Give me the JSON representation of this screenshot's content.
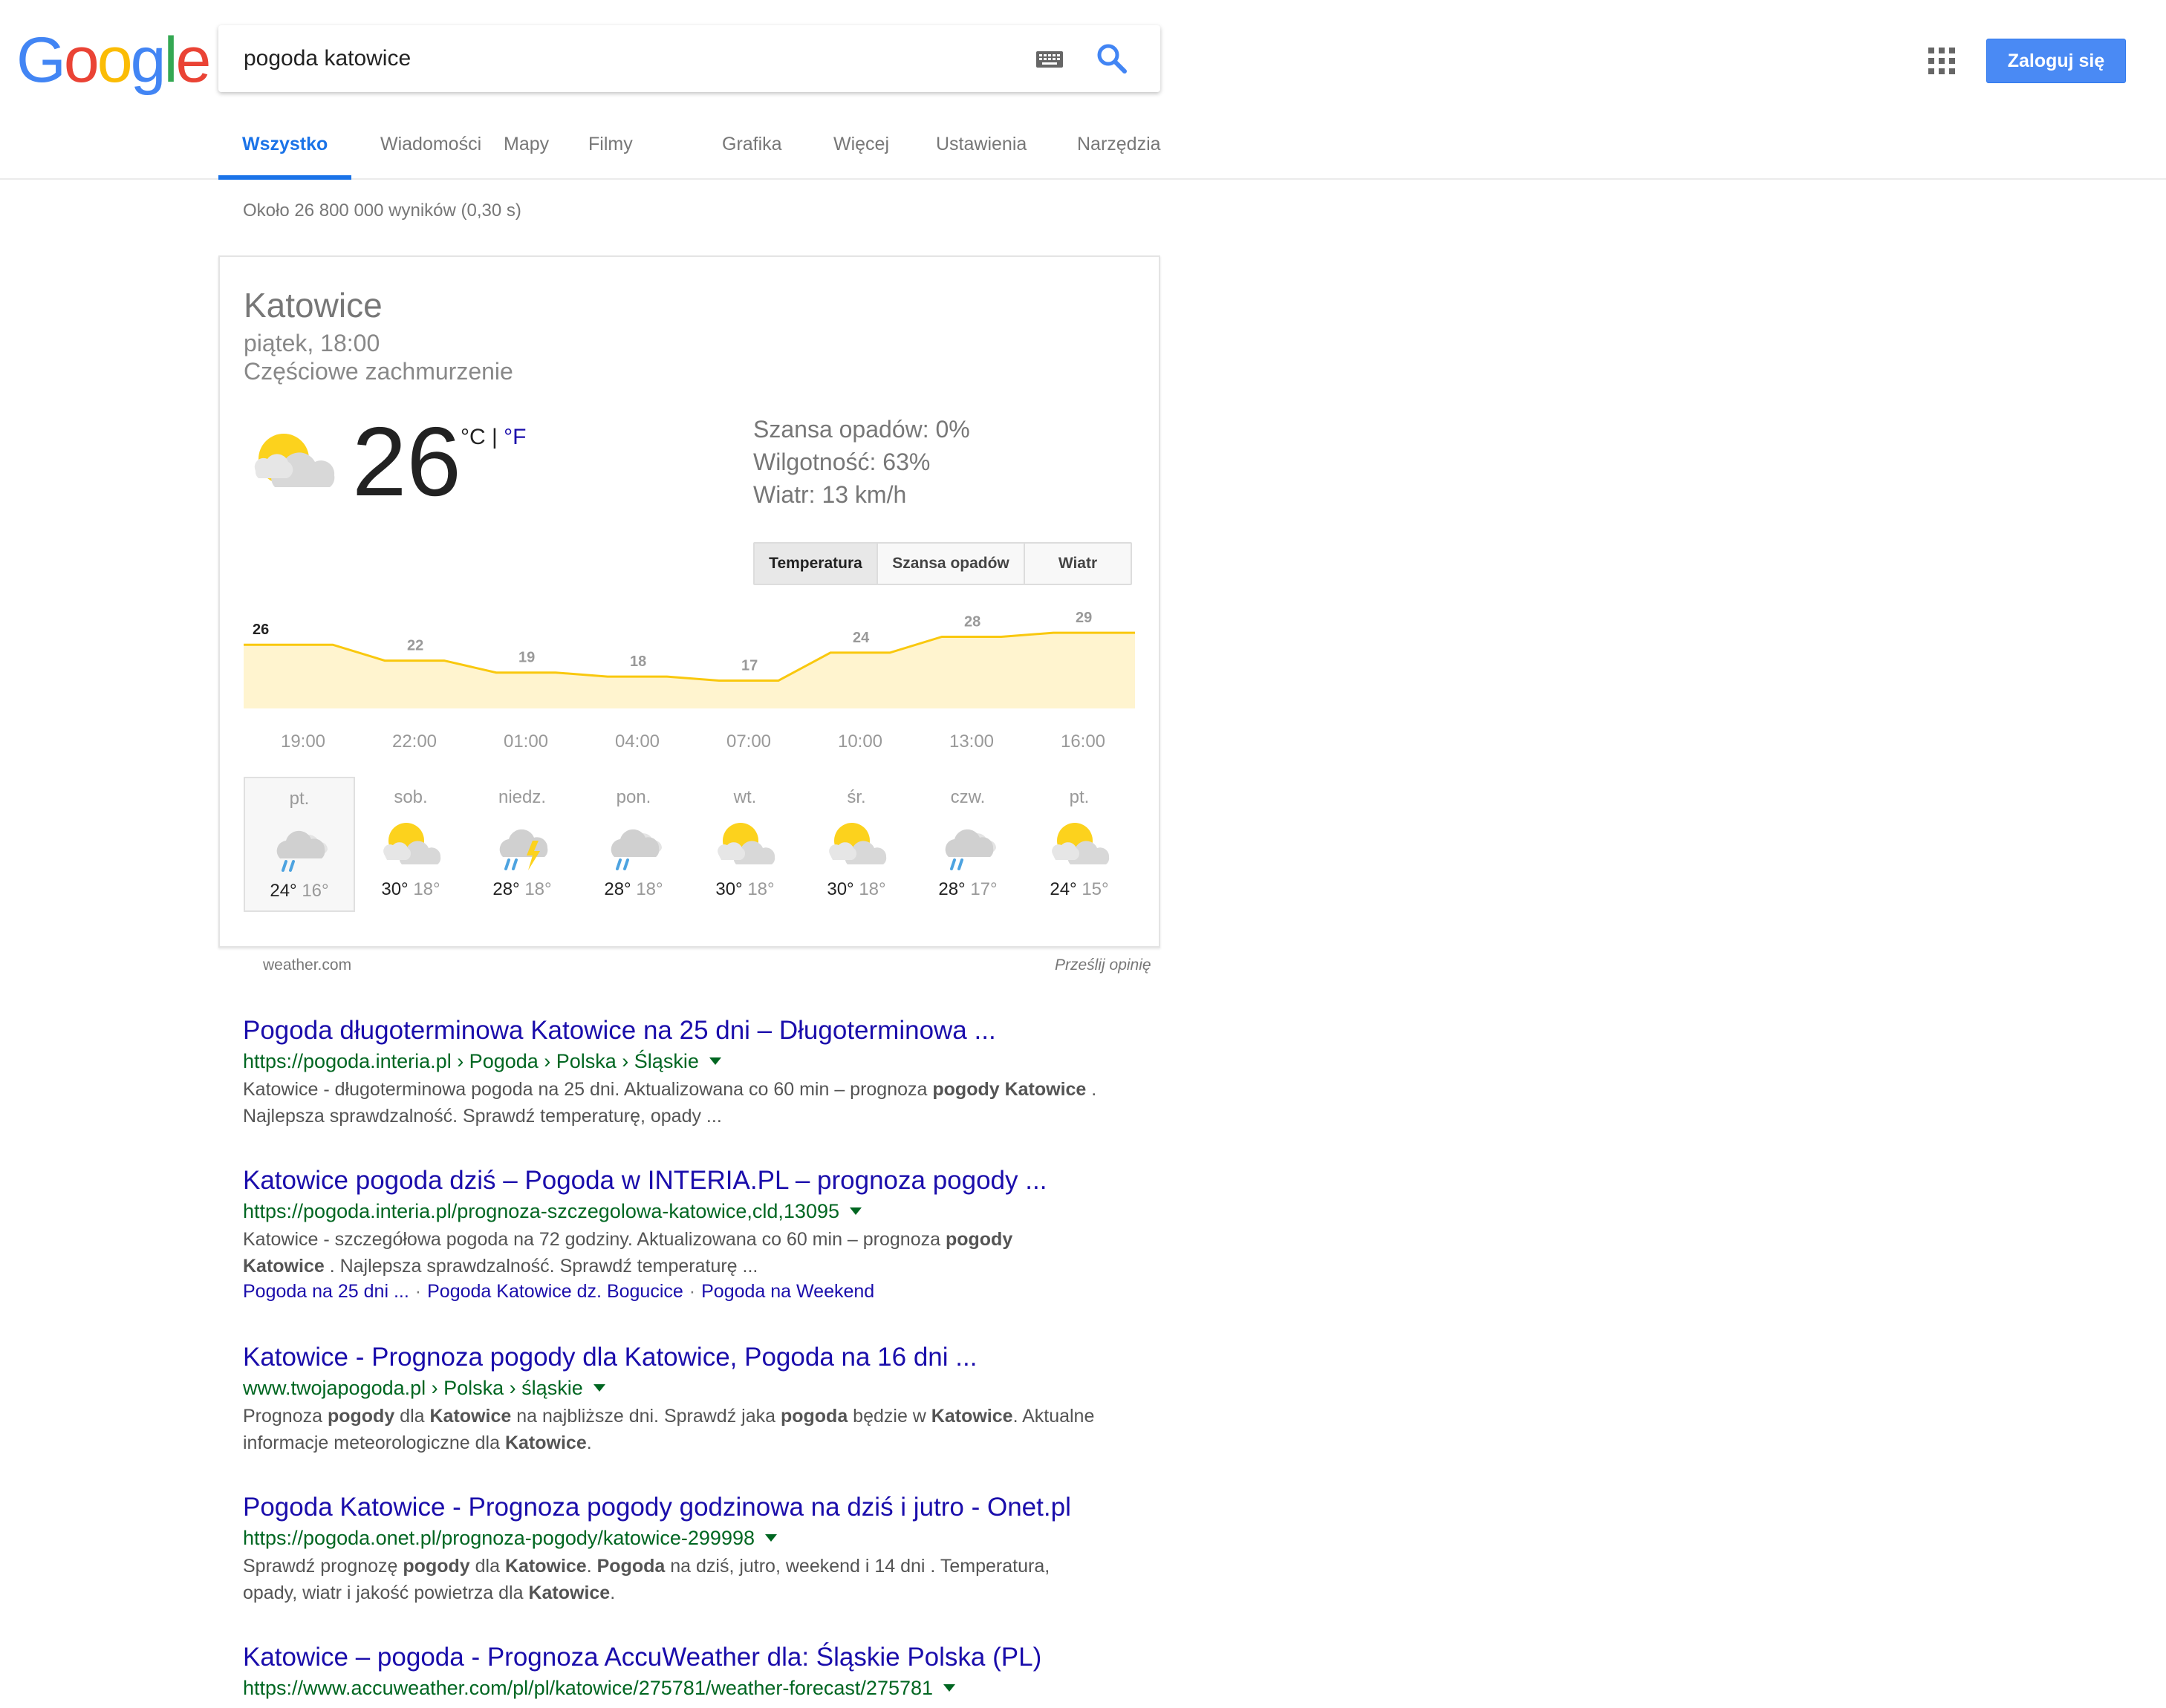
{
  "header": {
    "logo_letters": [
      {
        "ch": "G",
        "color": "#4285F4"
      },
      {
        "ch": "o",
        "color": "#EA4335"
      },
      {
        "ch": "o",
        "color": "#FBBC05"
      },
      {
        "ch": "g",
        "color": "#4285F4"
      },
      {
        "ch": "l",
        "color": "#34A853"
      },
      {
        "ch": "e",
        "color": "#EA4335"
      }
    ],
    "search_value": "pogoda katowice",
    "login_label": "Zaloguj się",
    "accent_color": "#4a8af4"
  },
  "tabs": [
    {
      "label": "Wszystko",
      "active": true
    },
    {
      "label": "Wiadomości",
      "active": false
    },
    {
      "label": "Mapy",
      "active": false
    },
    {
      "label": "Filmy",
      "active": false
    },
    {
      "label": "Grafika",
      "active": false
    },
    {
      "label": "Więcej",
      "active": false
    },
    {
      "label": "Ustawienia",
      "active": false
    },
    {
      "label": "Narzędzia",
      "active": false
    }
  ],
  "result_stats": "Około 26 800 000 wyników (0,30 s)",
  "weather": {
    "city": "Katowice",
    "time": "piątek, 18:00",
    "description": "Częściowe zachmurzenie",
    "icon": "partly-cloudy-icon",
    "temperature": "26",
    "unit_c": "°C",
    "unit_sep": " | ",
    "unit_f": "°F",
    "precipitation": "Szansa opadów: 0%",
    "humidity": "Wilgotność: 63%",
    "wind": "Wiatr: 13 km/h",
    "buttons": [
      {
        "label": "Temperatura",
        "selected": true
      },
      {
        "label": "Szansa opadów",
        "selected": false
      },
      {
        "label": "Wiatr",
        "selected": false
      }
    ],
    "hourly": [
      {
        "time": "19:00",
        "temp": "26",
        "value": 26
      },
      {
        "time": "22:00",
        "temp": "22",
        "value": 22
      },
      {
        "time": "01:00",
        "temp": "19",
        "value": 19
      },
      {
        "time": "04:00",
        "temp": "18",
        "value": 18
      },
      {
        "time": "07:00",
        "temp": "17",
        "value": 17
      },
      {
        "time": "10:00",
        "temp": "24",
        "value": 24
      },
      {
        "time": "13:00",
        "temp": "28",
        "value": 28
      },
      {
        "time": "16:00",
        "temp": "29",
        "value": 29
      }
    ],
    "days": [
      {
        "name": "pt.",
        "icon": "rain-cloud-icon",
        "hi": "24°",
        "lo": "16°",
        "selected": true
      },
      {
        "name": "sob.",
        "icon": "partly-cloudy-icon",
        "hi": "30°",
        "lo": "18°",
        "selected": false
      },
      {
        "name": "niedz.",
        "icon": "thunderstorm-icon",
        "hi": "28°",
        "lo": "18°",
        "selected": false
      },
      {
        "name": "pon.",
        "icon": "rain-cloud-icon",
        "hi": "28°",
        "lo": "18°",
        "selected": false
      },
      {
        "name": "wt.",
        "icon": "partly-cloudy-icon",
        "hi": "30°",
        "lo": "18°",
        "selected": false
      },
      {
        "name": "śr.",
        "icon": "partly-cloudy-icon",
        "hi": "30°",
        "lo": "18°",
        "selected": false
      },
      {
        "name": "czw.",
        "icon": "rain-cloud-icon",
        "hi": "28°",
        "lo": "17°",
        "selected": false
      },
      {
        "name": "pt.",
        "icon": "partly-cloudy-icon",
        "hi": "24°",
        "lo": "15°",
        "selected": false
      }
    ],
    "source": "weather.com",
    "feedback": "Prześlij opinię",
    "chart_color": "#f9c80e",
    "chart_fill": "#fff4cf"
  },
  "results": [
    {
      "title": "Pogoda długoterminowa Katowice na 25 dni – Długoterminowa ...",
      "url": "https://pogoda.interia.pl › Pogoda › Polska › Śląskie",
      "snippet": [
        [
          {
            "t": "Katowice - długoterminowa pogoda na 25 dni. Aktualizowana co 60 min – prognoza "
          },
          {
            "t": "pogody Katowice",
            "b": true
          },
          {
            "t": " ."
          }
        ],
        [
          {
            "t": "Najlepsza sprawdzalność. Sprawdź temperaturę, opady ..."
          }
        ]
      ],
      "links": []
    },
    {
      "title": "Katowice pogoda dziś – Pogoda w INTERIA.PL – prognoza pogody ...",
      "url": "https://pogoda.interia.pl/prognoza-szczegolowa-katowice,cld,13095",
      "snippet": [
        [
          {
            "t": "Katowice - szczegółowa pogoda na 72 godziny. Aktualizowana co 60 min – prognoza "
          },
          {
            "t": "pogody",
            "b": true
          }
        ],
        [
          {
            "t": "Katowice",
            "b": true
          },
          {
            "t": " . Najlepsza sprawdzalność. Sprawdź temperaturę ..."
          }
        ]
      ],
      "links": [
        "Pogoda na 25 dni ...",
        "Pogoda Katowice dz. Bogucice",
        "Pogoda na Weekend"
      ]
    },
    {
      "title": "Katowice - Prognoza pogody dla Katowice, Pogoda na 16 dni ...",
      "url": "www.twojapogoda.pl › Polska › śląskie",
      "snippet": [
        [
          {
            "t": "Prognoza "
          },
          {
            "t": "pogody",
            "b": true
          },
          {
            "t": " dla "
          },
          {
            "t": "Katowice",
            "b": true
          },
          {
            "t": " na najbliższe dni. Sprawdź jaka "
          },
          {
            "t": "pogoda",
            "b": true
          },
          {
            "t": " będzie w "
          },
          {
            "t": "Katowice",
            "b": true
          },
          {
            "t": ". Aktualne"
          }
        ],
        [
          {
            "t": "informacje meteorologiczne dla "
          },
          {
            "t": "Katowice",
            "b": true
          },
          {
            "t": "."
          }
        ]
      ],
      "links": []
    },
    {
      "title": "Pogoda Katowice - Prognoza pogody godzinowa na dziś i jutro - Onet.pl",
      "url": "https://pogoda.onet.pl/prognoza-pogody/katowice-299998",
      "snippet": [
        [
          {
            "t": "Sprawdź prognozę "
          },
          {
            "t": "pogody",
            "b": true
          },
          {
            "t": " dla "
          },
          {
            "t": "Katowice",
            "b": true
          },
          {
            "t": ". "
          },
          {
            "t": "Pogoda",
            "b": true
          },
          {
            "t": " na dziś, jutro, weekend i 14 dni . Temperatura,"
          }
        ],
        [
          {
            "t": "opady, wiatr i jakość powietrza dla "
          },
          {
            "t": "Katowice",
            "b": true
          },
          {
            "t": "."
          }
        ]
      ],
      "links": []
    },
    {
      "title": "Katowice – pogoda - Prognoza AccuWeather dla: Śląskie Polska (PL)",
      "url": "https://www.accuweather.com/pl/pl/katowice/275781/weather-forecast/275781",
      "snippet": [],
      "links": []
    }
  ]
}
